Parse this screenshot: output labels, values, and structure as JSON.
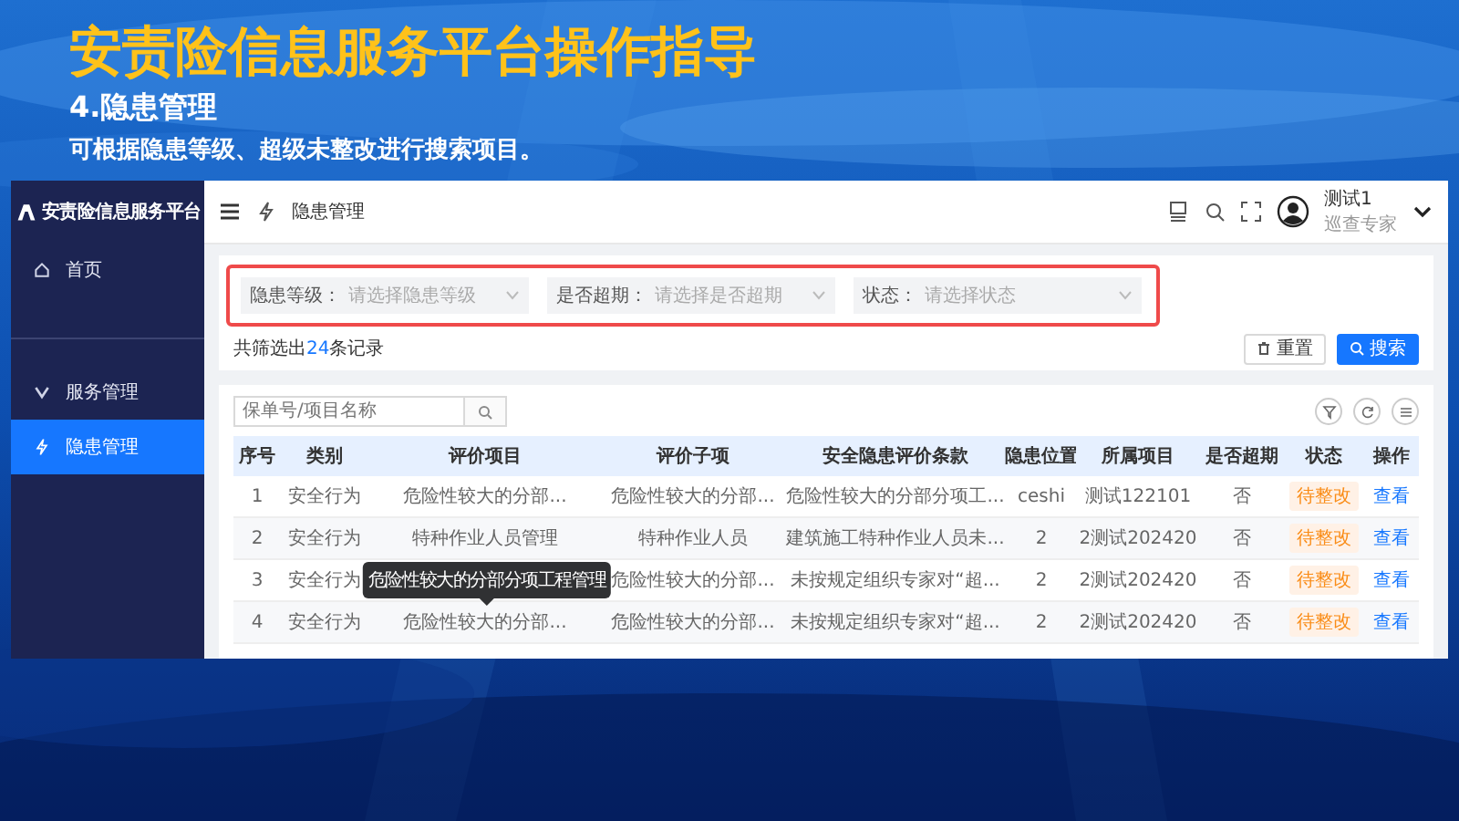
{
  "slide": {
    "title": "安责险信息服务平台操作指导",
    "subtitle": "4.隐患管理",
    "description": "可根据隐患等级、超级未整改进行搜索项目。"
  },
  "sidebar": {
    "brand": "安责险信息服务平台",
    "items": [
      {
        "label": "首页",
        "kind": "home",
        "selected": false
      },
      {
        "label": "服务管理",
        "kind": "service",
        "selected": false
      },
      {
        "label": "隐患管理",
        "kind": "hazard",
        "selected": true
      }
    ]
  },
  "topbar": {
    "breadcrumb": "隐患管理",
    "user": {
      "name": "测试1",
      "role": "巡查专家"
    }
  },
  "filters": [
    {
      "label": "隐患等级：",
      "placeholder": "请选择隐患等级"
    },
    {
      "label": "是否超期：",
      "placeholder": "请选择是否超期"
    },
    {
      "label": "状态：",
      "placeholder": "请选择状态"
    }
  ],
  "record_count": {
    "prefix": "共筛选出",
    "count": "24",
    "suffix": "条记录"
  },
  "buttons": [
    {
      "label": "重置",
      "kind": "reset"
    },
    {
      "label": "搜索",
      "kind": "search"
    }
  ],
  "table_search": {
    "placeholder": "保单号/项目名称"
  },
  "table": {
    "columns": [
      "序号",
      "类别",
      "评价项目",
      "评价子项",
      "安全隐患评价条款",
      "隐患位置",
      "所属项目",
      "是否超期",
      "状态",
      "操作"
    ],
    "rows": [
      {
        "cells": [
          "1",
          "安全行为",
          "危险性较大的分部...",
          "危险性较大的分部...",
          "危险性较大的分部分项工...",
          "ceshi",
          "测试122101",
          "否"
        ],
        "status": "待整改",
        "action": "查看"
      },
      {
        "cells": [
          "2",
          "安全行为",
          "特种作业人员管理",
          "特种作业人员",
          "建筑施工特种作业人员未...",
          "2",
          "2测试202420",
          "否"
        ],
        "status": "待整改",
        "action": "查看"
      },
      {
        "cells": [
          "3",
          "安全行为",
          null,
          "危险性较大的分部...",
          "未按规定组织专家对“超...",
          "2",
          "2测试202420",
          "否"
        ],
        "status": "待整改",
        "action": "查看"
      },
      {
        "cells": [
          "4",
          "安全行为",
          "危险性较大的分部...",
          "危险性较大的分部...",
          "未按规定组织专家对“超...",
          "2",
          "2测试202420",
          "否"
        ],
        "status": "待整改",
        "action": "查看"
      }
    ],
    "tooltip": {
      "text": "危险性较大的分部分项工程管理"
    }
  }
}
